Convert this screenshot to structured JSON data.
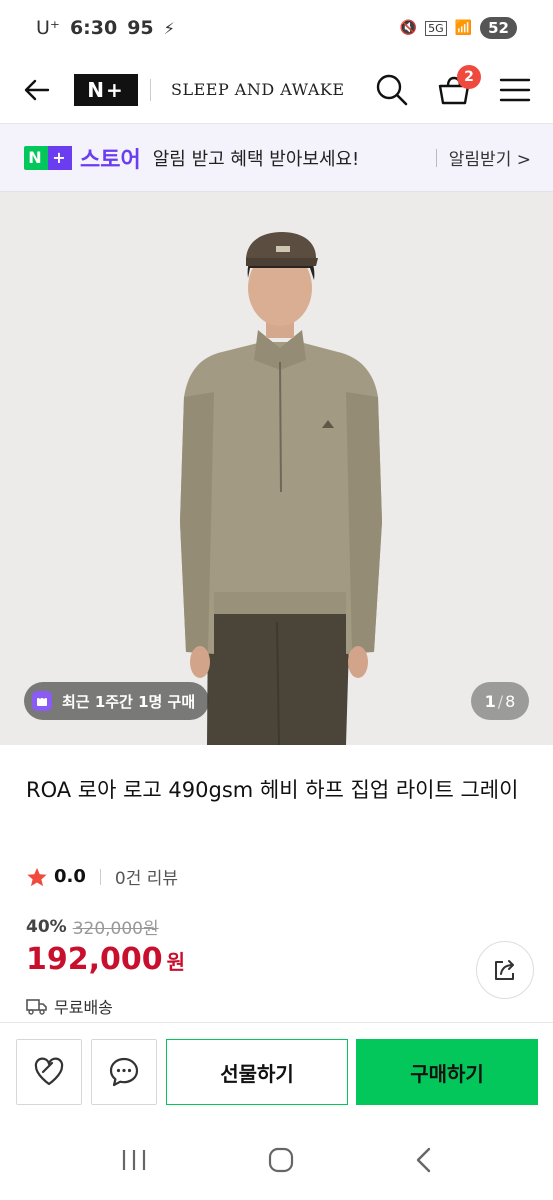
{
  "status_bar": {
    "carrier": "U⁺",
    "time": "6:30",
    "data_speed": "95",
    "network": "5G",
    "battery": "52"
  },
  "header": {
    "logo_text": "N+",
    "brand_name": "SLEEP AND AWAKE",
    "cart_count": "2"
  },
  "promo": {
    "badge_n": "N",
    "badge_plus": "+",
    "store_label": "스토어",
    "message": "알림 받고 혜택 받아보세요!",
    "link_label": "알림받기 >"
  },
  "gallery": {
    "recent_purchase": "최근 1주간 1명 구매",
    "current_page": "1",
    "total_pages": "8"
  },
  "product": {
    "title": "ROA 로아 로고 490gsm 헤비 하프 집업 라이트 그레이",
    "rating": "0.0",
    "review_count": "0건 리뷰",
    "discount_rate": "40%",
    "original_price": "320,000원",
    "price": "192,000",
    "price_unit": "원",
    "shipping": "무료배송"
  },
  "actions": {
    "gift_label": "선물하기",
    "buy_label": "구매하기"
  },
  "colors": {
    "naver_green": "#03c75a",
    "store_purple": "#6a3df0",
    "price_red": "#c8102e",
    "badge_red": "#f04a3e"
  }
}
